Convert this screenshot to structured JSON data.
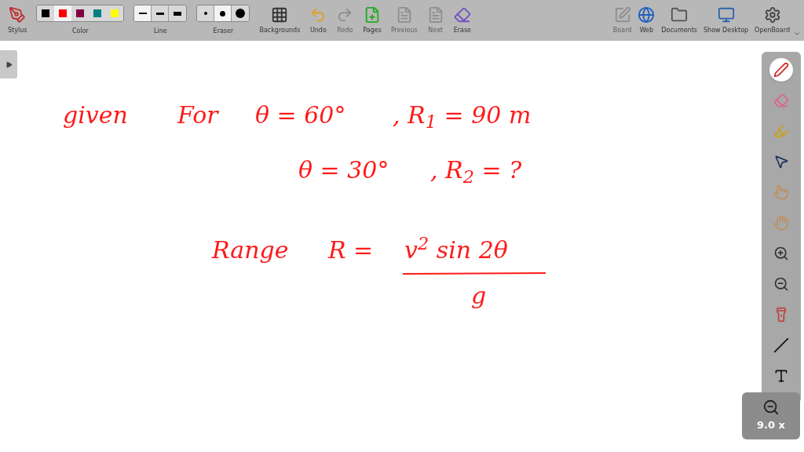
{
  "toolbar": {
    "left": [
      {
        "kind": "button",
        "label": "Stylus",
        "disabled": false
      },
      {
        "kind": "palette",
        "label": "Color",
        "options": [
          {
            "color": "#000000",
            "selected": false
          },
          {
            "color": "#ff0000",
            "selected": true
          },
          {
            "color": "#800040",
            "selected": false
          },
          {
            "color": "#008080",
            "selected": false
          },
          {
            "color": "#ffff00",
            "selected": false
          }
        ]
      },
      {
        "kind": "lines",
        "label": "Line",
        "options": [
          {
            "selected": true
          },
          {
            "selected": false
          },
          {
            "selected": false
          }
        ]
      },
      {
        "kind": "dots",
        "label": "Eraser",
        "options": [
          {
            "selected": false
          },
          {
            "selected": true
          },
          {
            "selected": false
          }
        ]
      },
      {
        "kind": "button",
        "label": "Backgrounds",
        "disabled": false
      },
      {
        "kind": "button",
        "label": "Undo",
        "disabled": false
      },
      {
        "kind": "button",
        "label": "Redo",
        "disabled": true
      },
      {
        "kind": "button",
        "label": "Pages",
        "disabled": false
      },
      {
        "kind": "button",
        "label": "Previous",
        "disabled": true
      },
      {
        "kind": "button",
        "label": "Next",
        "disabled": true
      },
      {
        "kind": "button",
        "label": "Erase",
        "disabled": false
      }
    ],
    "right": [
      {
        "label": "Board",
        "disabled": true
      },
      {
        "label": "Web",
        "disabled": false
      },
      {
        "label": "Documents",
        "disabled": false
      },
      {
        "label": "Show Desktop",
        "disabled": false
      },
      {
        "label": "OpenBoard",
        "disabled": false
      }
    ]
  },
  "board": {
    "ink": [
      {
        "text": "given"
      },
      {
        "text": "For"
      },
      {
        "text": "θ = 60°"
      },
      {
        "text": ", R$_{1}$ = 90 m"
      },
      {
        "text": "θ = 30°"
      },
      {
        "text": ", R$_{2}$ = ?"
      },
      {
        "text": "Range"
      },
      {
        "text": "R ="
      },
      {
        "text": "v$^{2}$ sin 2θ"
      },
      {
        "text": "g"
      }
    ]
  },
  "tools": [
    {
      "selected": true
    },
    {
      "selected": false
    },
    {
      "selected": false
    },
    {
      "selected": false
    },
    {
      "selected": false
    },
    {
      "selected": false
    },
    {
      "selected": false
    },
    {
      "selected": false
    },
    {
      "selected": false
    },
    {
      "selected": false
    },
    {
      "selected": false
    }
  ],
  "zoom": {
    "reading": "9.0 x"
  }
}
